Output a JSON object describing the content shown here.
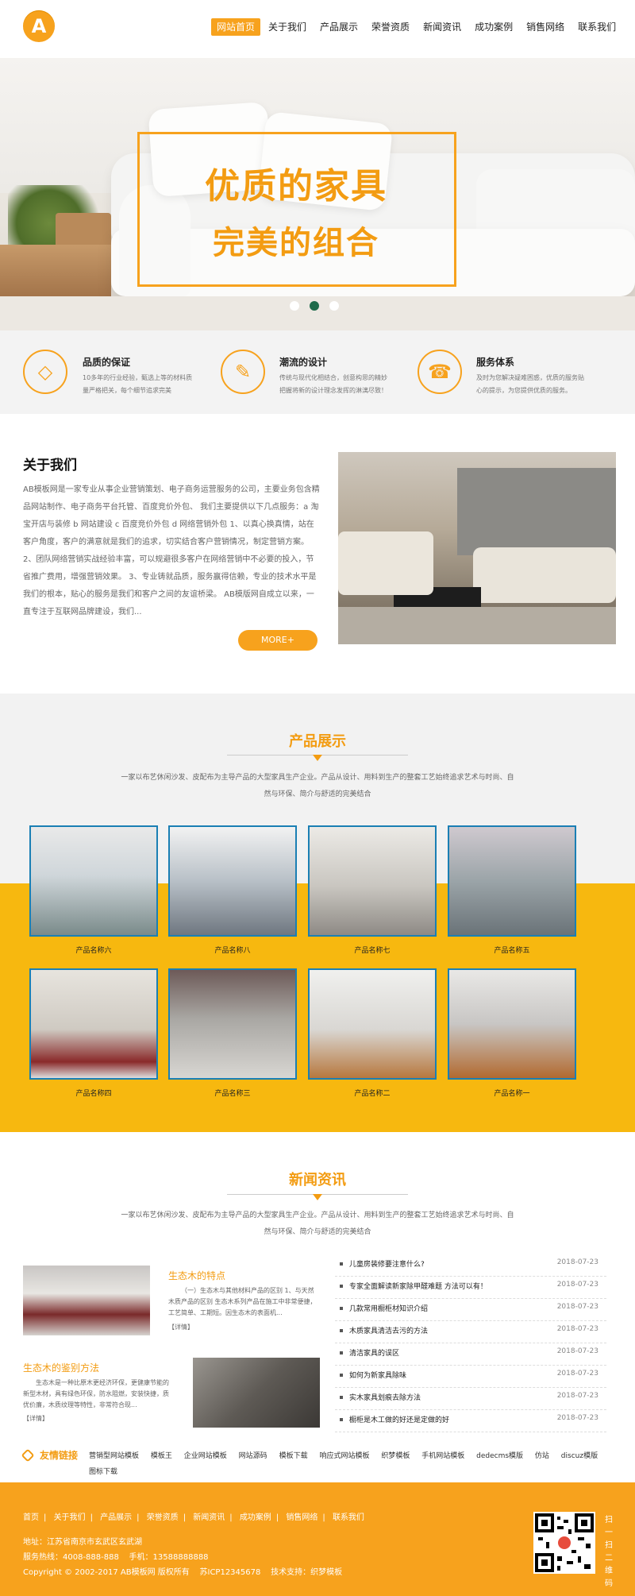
{
  "header": {
    "logo_letter": "A",
    "nav": [
      "网站首页",
      "关于我们",
      "产品展示",
      "荣誉资质",
      "新闻资讯",
      "成功案例",
      "销售网络",
      "联系我们"
    ]
  },
  "banner": {
    "line1": "优质的家具",
    "line2": "完美的组合",
    "dots": 3,
    "active_dot": 2
  },
  "features": [
    {
      "icon": "diamond-icon",
      "glyph": "◇",
      "title": "品质的保证",
      "text": "10多年的行业经验，甄选上等的材料质量严格把关，每个细节追求完美"
    },
    {
      "icon": "pencil-icon",
      "glyph": "✎",
      "title": "潮流的设计",
      "text": "传统与现代化相结合，创意构思的精妙把握将新的设计理念发挥的淋漓尽致！"
    },
    {
      "icon": "headset-icon",
      "glyph": "☎",
      "title": "服务体系",
      "text": "及时为您解决疑难困惑，优质的服务贴心的提示，为您提供优质的服务。"
    }
  ],
  "about": {
    "title": "关于我们",
    "text": "AB模板网是一家专业从事企业营销策划、电子商务运营服务的公司，主要业务包含精品网站制作、电子商务平台托管、百度竞价外包、 我们主要提供以下几点服务：a 淘宝开店与装修 b 网站建设 c 百度竞价外包 d 网络营销外包 1、以真心换真情，站在客户角度，客户的满意就是我们的追求，切实结合客户营销情况，制定营销方案。 2、团队网络营销实战经验丰富，可以规避很多客户在网络营销中不必要的投入，节省推广费用，增强营销效果。 3、专业铸就品质，服务赢得信赖，专业的技术水平是我们的根本，贴心的服务是我们和客户之间的友谊桥梁。 AB模版网自成立以来，一直专注于互联网品牌建设，我们...",
    "more": "MORE+"
  },
  "products": {
    "title": "产品展示",
    "desc": "一家以布艺休闲沙发、皮配布为主导产品的大型家具生产企业。产品从设计、用料到生产的整套工艺始终追求艺术与时尚、自然与环保、简介与舒适的完美结合",
    "items": [
      "产品名称六",
      "产品名称八",
      "产品名称七",
      "产品名称五",
      "产品名称四",
      "产品名称三",
      "产品名称二",
      "产品名称一"
    ]
  },
  "news": {
    "title": "新闻资讯",
    "desc": "一家以布艺休闲沙发、皮配布为主导产品的大型家具生产企业。产品从设计、用料到生产的整套工艺始终追求艺术与时尚、自然与环保、简介与舒适的完美结合",
    "feature1": {
      "title": "生态木的特点",
      "text": "（一）生态木与其他材料产品的区别 1、与天然木质产品的区别 生态木系列产品在施工中非常便捷，工艺简单、工期短。因生态木的表面机...",
      "more": "【详情】"
    },
    "feature2": {
      "title": "生态木的鉴别方法",
      "text": "生态木是一种比原木更经济环保，更健康节能的新型木材，具有绿色环保，防水阻燃，安装快捷，质优价廉，木质纹理等特性，非常符合现...",
      "more": "【详情】"
    },
    "list": [
      {
        "title": "儿童房装修要注意什么?",
        "date": "2018-07-23"
      },
      {
        "title": "专家全面解读新家除甲醛难题 方法可以有！",
        "date": "2018-07-23"
      },
      {
        "title": "几款常用橱柜材知识介绍",
        "date": "2018-07-23"
      },
      {
        "title": "木质家具清洁去污的方法",
        "date": "2018-07-23"
      },
      {
        "title": "清洁家具的误区",
        "date": "2018-07-23"
      },
      {
        "title": "如何为新家具除味",
        "date": "2018-07-23"
      },
      {
        "title": "实木家具划痕去除方法",
        "date": "2018-07-23"
      },
      {
        "title": "橱柜是木工做的好还是定做的好",
        "date": "2018-07-23"
      }
    ]
  },
  "links": {
    "title": "友情链接",
    "items": [
      "营销型网站模板",
      "模板王",
      "企业网站模板",
      "网站源码",
      "模板下载",
      "响应式网站模板",
      "织梦模板",
      "手机网站模板",
      "dedecms模版",
      "仿站",
      "discuz模版",
      "图标下载"
    ]
  },
  "footer": {
    "nav": [
      "首页",
      "关于我们",
      "产品展示",
      "荣誉资质",
      "新闻资讯",
      "成功案例",
      "销售网络",
      "联系我们"
    ],
    "address": "地址：江苏省南京市玄武区玄武湖",
    "phone": "服务热线：4008-888-888    手机：13588888888",
    "copyright": "Copyright © 2002-2017 AB模板网 版权所有    苏ICP12345678    技术支持：织梦模板",
    "qr_text": "扫一扫二维码"
  },
  "colors": {
    "accent": "#f7a21d",
    "yellow_band": "#f7b80f",
    "card_border": "#1a7fb4"
  }
}
